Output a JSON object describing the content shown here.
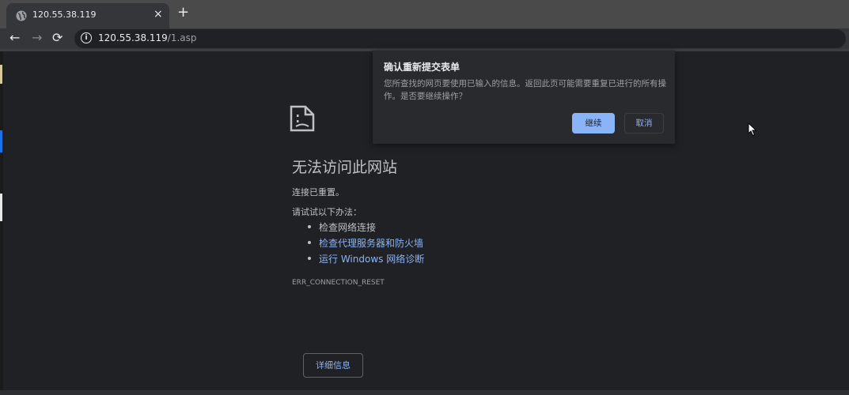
{
  "browser": {
    "tab": {
      "title": "120.55.38.119",
      "icon": "globe-icon",
      "close_label": "×"
    },
    "new_tab_label": "+",
    "nav": {
      "back": "←",
      "forward": "→",
      "reload": "⟳"
    },
    "omnibox": {
      "info_icon": "i",
      "host": "120.55.38.119",
      "path": "/1.asp"
    }
  },
  "error_page": {
    "icon": "sad-page-icon",
    "title": "无法访问此网站",
    "subtitle": "连接已重置。",
    "try_label": "请试试以下办法：",
    "suggestions": [
      {
        "text": "检查网络连接",
        "link": false
      },
      {
        "text": "检查代理服务器和防火墙",
        "link": true
      },
      {
        "text": "运行 Windows 网络诊断",
        "link": true
      }
    ],
    "error_code": "ERR_CONNECTION_RESET",
    "details_button": "详细信息"
  },
  "dialog": {
    "title": "确认重新提交表单",
    "message": "您所查找的网页要使用已输入的信息。返回此页可能需要重复已进行的所有操作。是否要继续操作？",
    "continue_button": "继续",
    "cancel_button": "取消"
  },
  "colors": {
    "accent": "#8ab4f8",
    "background": "#202124",
    "text": "#bdc1c6"
  }
}
